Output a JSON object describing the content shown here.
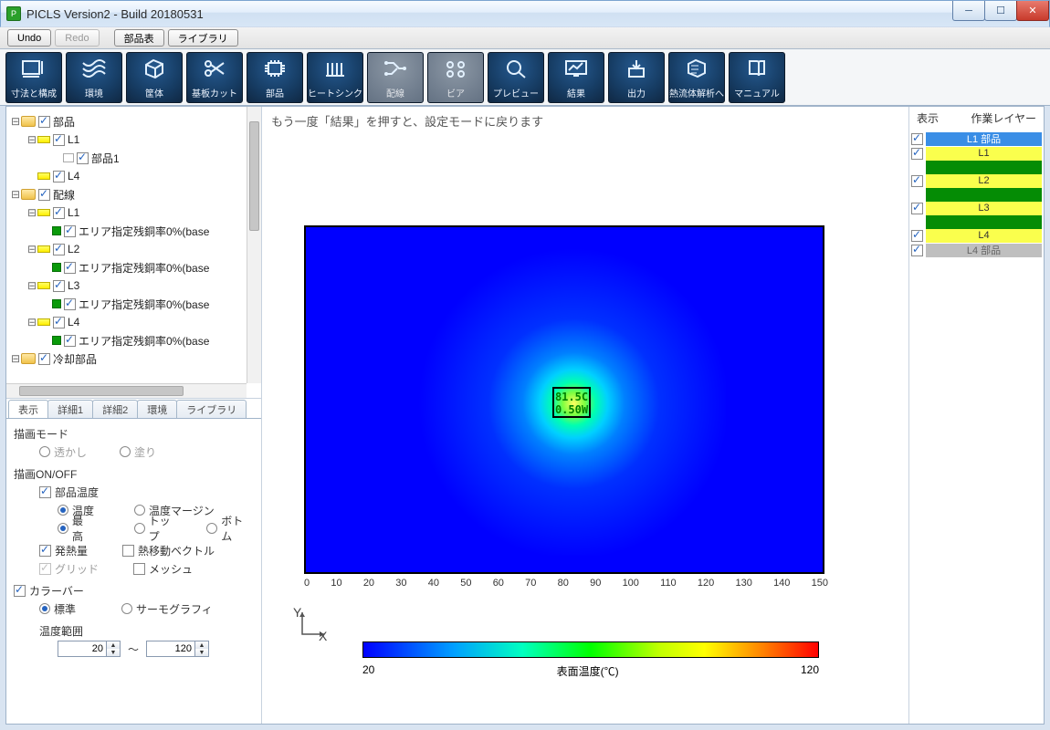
{
  "window": {
    "title": "PICLS Version2 - Build 20180531"
  },
  "subbar": {
    "undo": "Undo",
    "redo": "Redo",
    "partsTable": "部品表",
    "library": "ライブラリ"
  },
  "toolbar": [
    {
      "label": "寸法と構成",
      "disabled": false
    },
    {
      "label": "環境",
      "disabled": false
    },
    {
      "label": "筐体",
      "disabled": false
    },
    {
      "label": "基板カット",
      "disabled": false
    },
    {
      "label": "部品",
      "disabled": false
    },
    {
      "label": "ヒートシンク",
      "disabled": false
    },
    {
      "label": "配線",
      "disabled": true
    },
    {
      "label": "ビア",
      "disabled": true
    },
    {
      "label": "プレビュー",
      "disabled": false
    },
    {
      "label": "結果",
      "disabled": false
    },
    {
      "label": "出力",
      "disabled": false
    },
    {
      "label": "熱流体解析へ",
      "disabled": false
    },
    {
      "label": "マニュアル",
      "disabled": false
    }
  ],
  "tree": {
    "root1": "部品",
    "r1_L1": "L1",
    "r1_L1_c0": "部品1",
    "r1_L4": "L4",
    "root2": "配線",
    "r2_L1": "L1",
    "r2_L1_c0": "エリア指定残銅率0%(base",
    "r2_L2": "L2",
    "r2_L2_c0": "エリア指定残銅率0%(base",
    "r2_L3": "L3",
    "r2_L3_c0": "エリア指定残銅率0%(base",
    "r2_L4": "L4",
    "r2_L4_c0": "エリア指定残銅率0%(base",
    "root3": "冷却部品"
  },
  "tabs": {
    "t0": "表示",
    "t1": "詳細1",
    "t2": "詳細2",
    "t3": "環境",
    "t4": "ライブラリ"
  },
  "props": {
    "drawMode": "描画モード",
    "transparent": "透かし",
    "fill": "塗り",
    "drawOnOff": "描画ON/OFF",
    "partTemp": "部品温度",
    "temp": "温度",
    "tempMargin": "温度マージン",
    "max": "最高",
    "top": "トップ",
    "bottom": "ボトム",
    "heat": "発熱量",
    "heatTransferVector": "熱移動ベクトル",
    "grid": "グリッド",
    "mesh": "メッシュ",
    "colorbar": "カラーバー",
    "standard": "標準",
    "thermography": "サーモグラフィ",
    "tempRange": "温度範囲",
    "rangeMin": "20",
    "rangeMax": "120",
    "tilde": "～"
  },
  "viewport": {
    "msg": "もう一度「結果」を押すと、設定モードに戻ります",
    "part_line1": "81.5C",
    "part_line2": "0.50W",
    "axis_x_ticks": [
      "0",
      "10",
      "20",
      "30",
      "40",
      "50",
      "60",
      "70",
      "80",
      "90",
      "100",
      "110",
      "120",
      "130",
      "140",
      "150"
    ],
    "axisY": "Y",
    "axisX": "X",
    "legend_min": "20",
    "legend_max": "120",
    "legend_label": "表面温度(℃)"
  },
  "right": {
    "head_show": "表示",
    "head_layer": "作業レイヤー",
    "layers": [
      {
        "name": "L1 部品",
        "cls": "sel"
      },
      {
        "name": "L1",
        "cls": "yellow"
      },
      {
        "name": "",
        "cls": "green"
      },
      {
        "name": "L2",
        "cls": "yellow"
      },
      {
        "name": "",
        "cls": "green"
      },
      {
        "name": "L3",
        "cls": "yellow"
      },
      {
        "name": "",
        "cls": "green"
      },
      {
        "name": "L4",
        "cls": "yellow"
      },
      {
        "name": "L4 部品",
        "cls": "gray"
      }
    ]
  },
  "chart_data": {
    "type": "heatmap",
    "title": "表面温度(℃)",
    "xlabel": "X",
    "ylabel": "Y",
    "xlim": [
      0,
      150
    ],
    "ylim": [
      0,
      100
    ],
    "colorbar_range": [
      20,
      120
    ],
    "hotspot": {
      "x": 75,
      "y": 50,
      "temp_c": 81.5,
      "power_w": 0.5
    },
    "description": "Radial thermal gradient centered near (75,50); peak ~81.5°C at part location, decaying towards ambient across the 150×100 board area."
  }
}
